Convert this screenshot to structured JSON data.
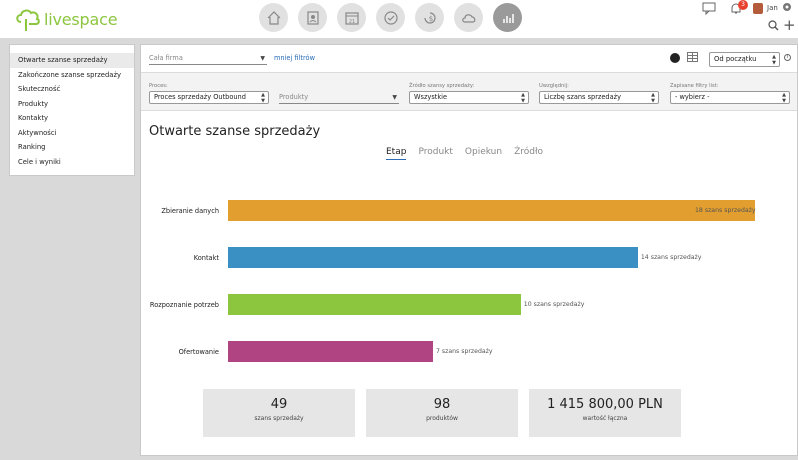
{
  "app": {
    "name": "livespace"
  },
  "nav": [
    "home-icon",
    "contacts-icon",
    "calendar-icon",
    "tasks-icon",
    "deals-icon",
    "cloud-icon",
    "reports-icon"
  ],
  "user": {
    "name": "Jan",
    "notifications": "3"
  },
  "sidebar": {
    "items": [
      {
        "label": "Otwarte szanse sprzedaży",
        "active": true
      },
      {
        "label": "Zakończone szanse sprzedaży"
      },
      {
        "label": "Skuteczność"
      },
      {
        "label": "Produkty"
      },
      {
        "label": "Kontakty"
      },
      {
        "label": "Aktywności"
      },
      {
        "label": "Ranking"
      },
      {
        "label": "Cele i wyniki"
      }
    ]
  },
  "filters": {
    "firm_placeholder": "Cała firma",
    "less_filters": "mniej filtrów",
    "period": "Od początku",
    "process_label": "Proces:",
    "process_value": "Proces sprzedaży Outbound",
    "products_placeholder": "Produkty",
    "source_label": "Źródło szansy sprzedaży:",
    "source_value": "Wszystkie",
    "include_label": "Uwzględnij:",
    "include_value": "Liczbę szans sprzedaży",
    "saved_label": "Zapisane filtry list:",
    "saved_value": "- wybierz -"
  },
  "page": {
    "title": "Otwarte szanse sprzedaży",
    "tabs": [
      "Etap",
      "Produkt",
      "Opiekun",
      "Źródło"
    ],
    "active_tab": "Etap"
  },
  "chart_data": {
    "type": "bar",
    "orientation": "horizontal",
    "categories": [
      "Zbieranie danych",
      "Kontakt",
      "Rozpoznanie potrzeb",
      "Ofertowanie"
    ],
    "values": [
      18,
      14,
      10,
      7
    ],
    "value_labels": [
      "18 szans sprzedaży",
      "14 szans sprzedaży",
      "10 szans sprzedaży",
      "7 szans sprzedaży"
    ],
    "colors": [
      "#e29e2e",
      "#3a8fc3",
      "#8cc63f",
      "#b04483"
    ],
    "xlim": [
      0,
      18
    ],
    "grid": false
  },
  "stats": [
    {
      "value": "49",
      "label": "szans sprzedaży"
    },
    {
      "value": "98",
      "label": "produktów"
    },
    {
      "value": "1 415 800,00 PLN",
      "label": "wartość łączna"
    }
  ]
}
